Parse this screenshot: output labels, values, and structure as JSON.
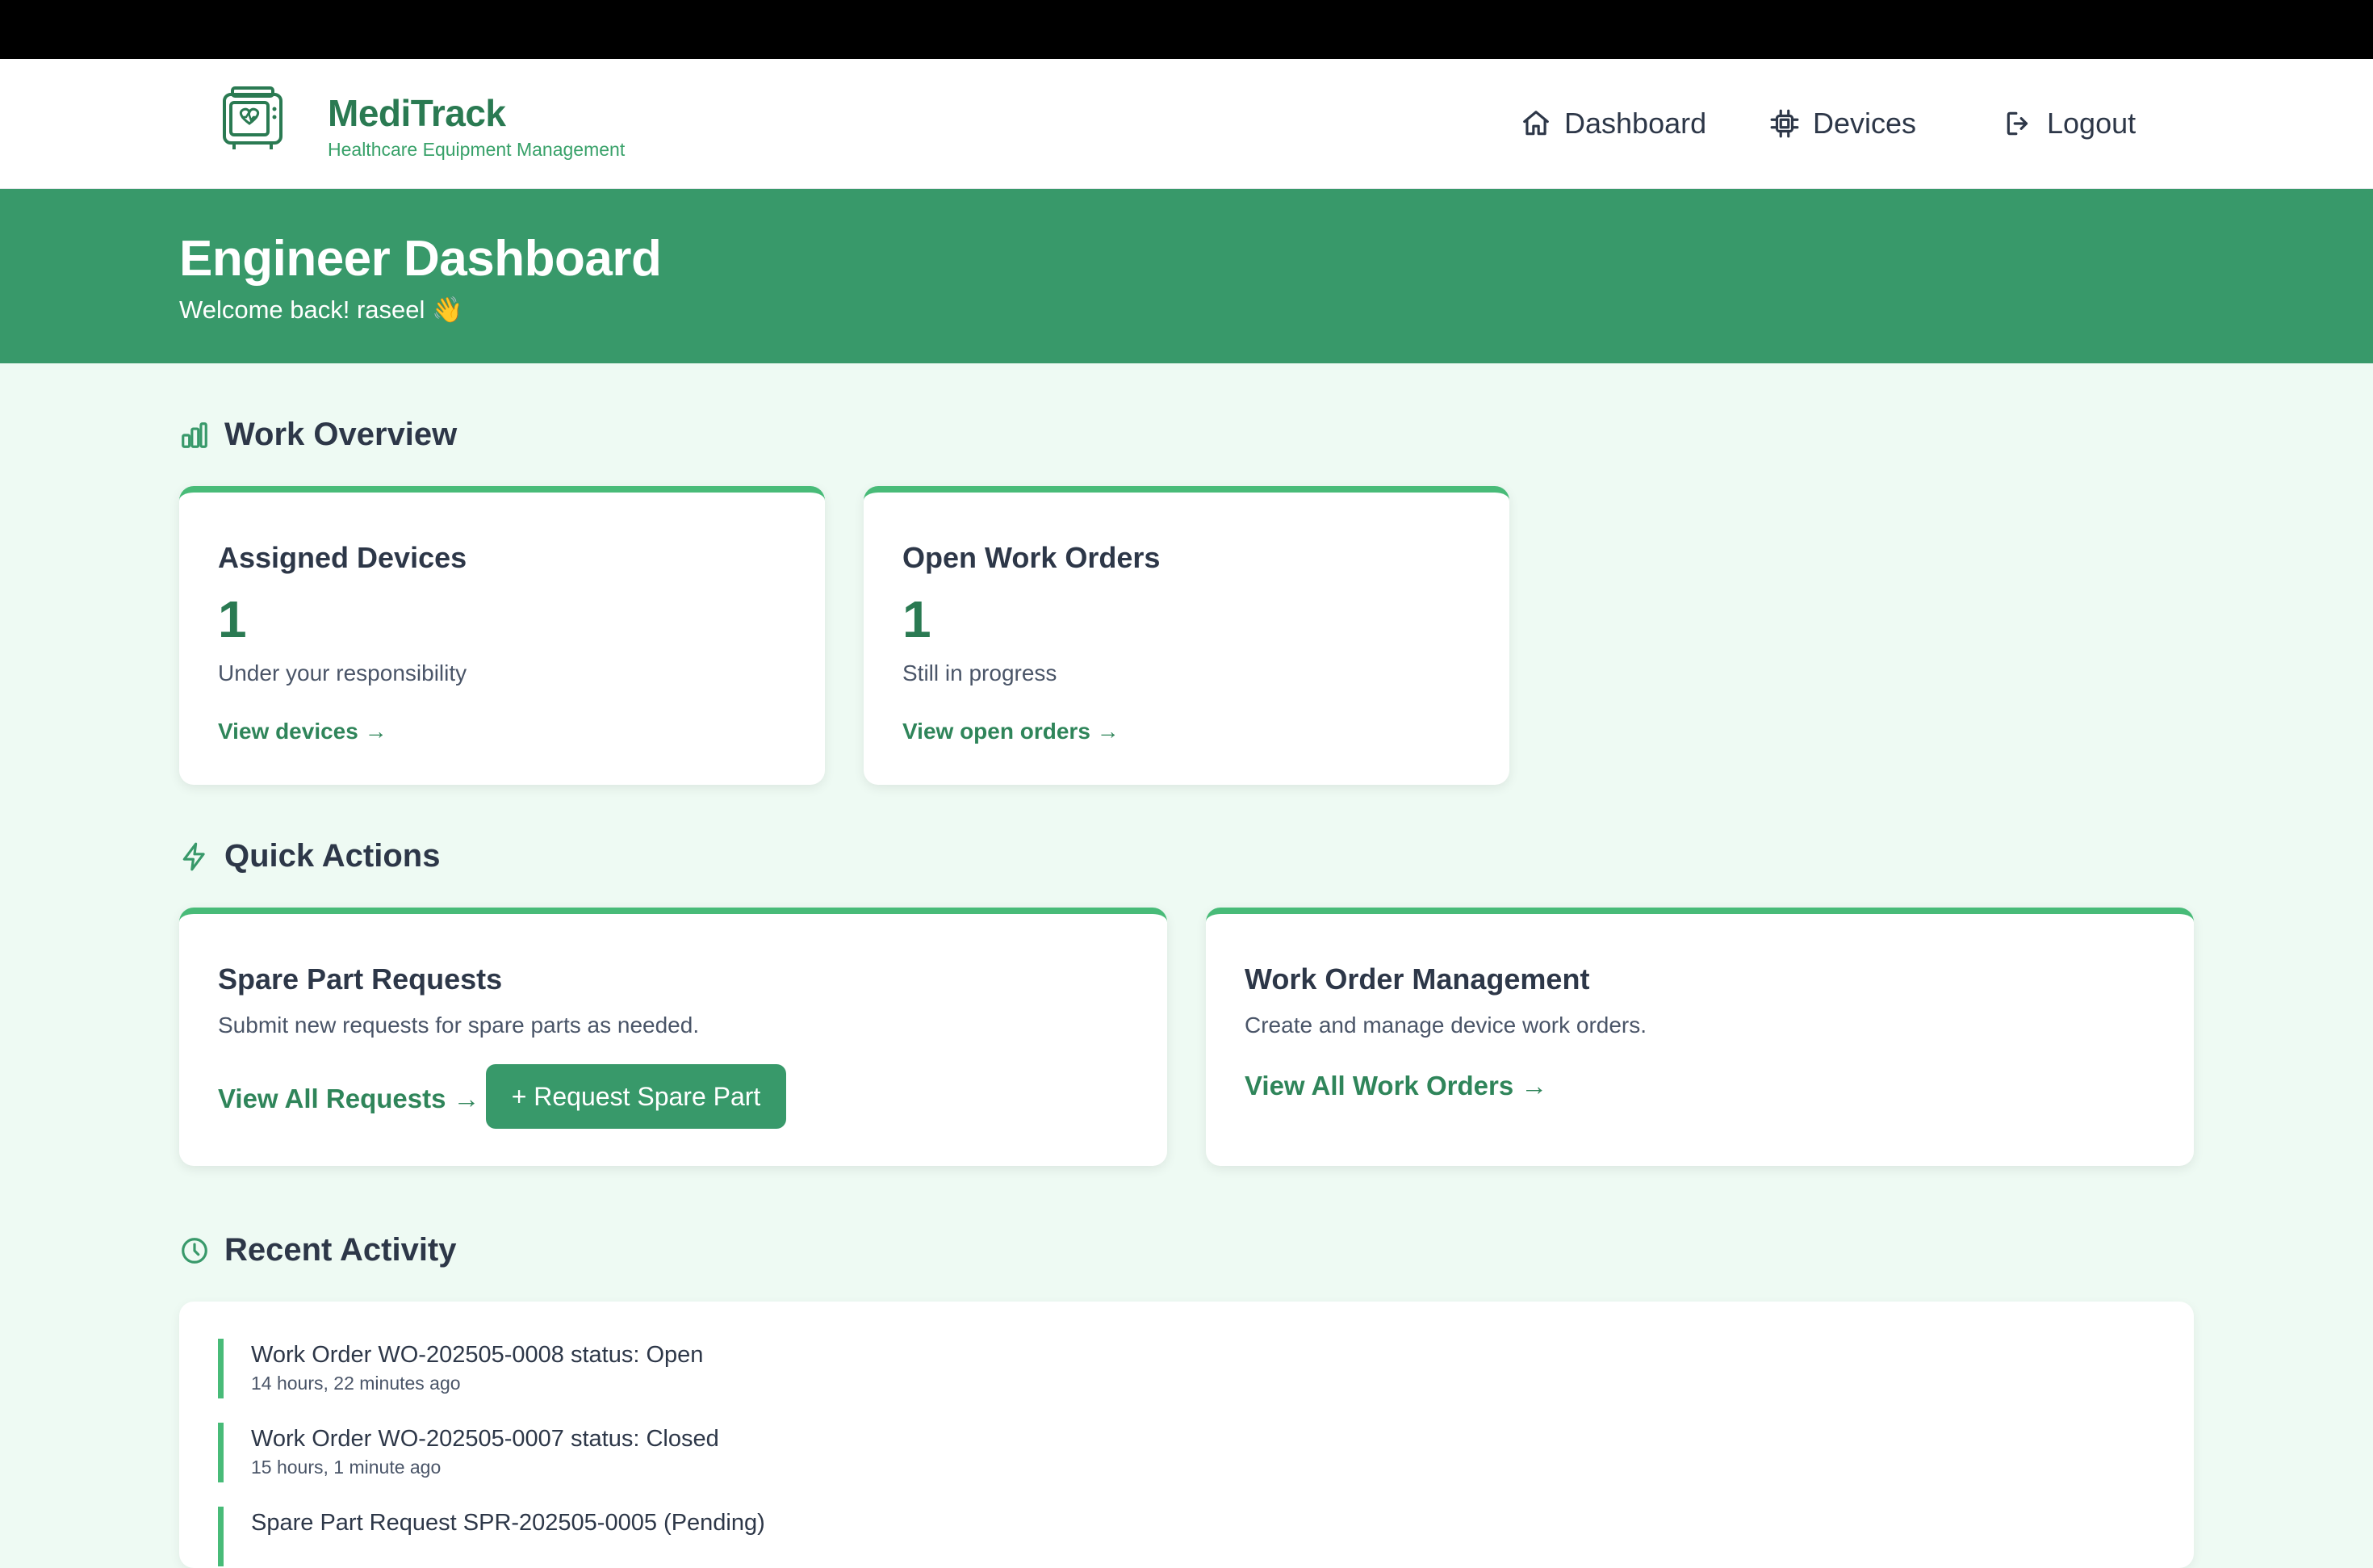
{
  "brand": {
    "name": "MediTrack",
    "subtitle": "Healthcare Equipment Management"
  },
  "nav": {
    "dashboard": "Dashboard",
    "devices": "Devices",
    "logout": "Logout"
  },
  "hero": {
    "title": "Engineer Dashboard",
    "welcome": "Welcome back! raseel 👋"
  },
  "work_overview": {
    "title": "Work Overview",
    "cards": [
      {
        "title": "Assigned Devices",
        "value": "1",
        "desc": "Under your responsibility",
        "link": "View devices →"
      },
      {
        "title": "Open Work Orders",
        "value": "1",
        "desc": "Still in progress",
        "link": "View open orders →"
      }
    ]
  },
  "quick_actions": {
    "title": "Quick Actions",
    "spare_parts": {
      "title": "Spare Part Requests",
      "desc": "Submit new requests for spare parts as needed.",
      "link": "View All Requests →",
      "button": "+ Request Spare Part"
    },
    "work_orders": {
      "title": "Work Order Management",
      "desc": "Create and manage device work orders.",
      "link": "View All Work Orders →"
    }
  },
  "recent_activity": {
    "title": "Recent Activity",
    "items": [
      {
        "text": "Work Order WO-202505-0008 status: Open",
        "time": "14 hours, 22 minutes ago"
      },
      {
        "text": "Work Order WO-202505-0007 status: Closed",
        "time": "15 hours, 1 minute ago"
      },
      {
        "text": "Spare Part Request SPR-202505-0005 (Pending)",
        "time": ""
      }
    ]
  },
  "colors": {
    "primary": "#38996a",
    "accent": "#48bb78",
    "brand_text": "#2a7a52",
    "background": "#eefaf3"
  }
}
